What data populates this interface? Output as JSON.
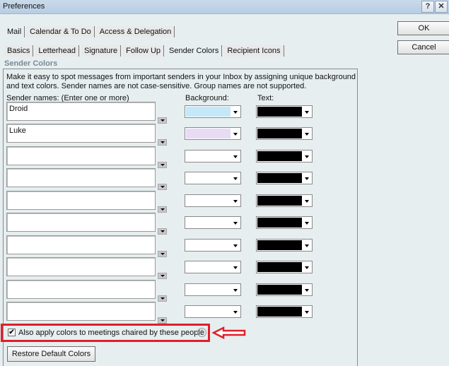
{
  "window": {
    "title": "Preferences",
    "help_glyph": "?",
    "close_glyph": "✕"
  },
  "top_tabs": [
    {
      "label": "Mail",
      "active": true
    },
    {
      "label": "Calendar & To Do",
      "active": false
    },
    {
      "label": "Access & Delegation",
      "active": false
    }
  ],
  "sub_tabs": [
    {
      "label": "Basics",
      "active": false
    },
    {
      "label": "Letterhead",
      "active": false
    },
    {
      "label": "Signature",
      "active": false
    },
    {
      "label": "Follow Up",
      "active": false
    },
    {
      "label": "Sender Colors",
      "active": true
    },
    {
      "label": "Recipient Icons",
      "active": false
    }
  ],
  "buttons": {
    "ok": "OK",
    "cancel": "Cancel",
    "restore": "Restore Default Colors"
  },
  "section": {
    "title": "Sender Colors",
    "description": "Make it easy to spot messages from important senders in your Inbox by assigning unique background and text colors.  Sender names are not case-sensitive. Group names are not supported.",
    "col_names": "Sender names: (Enter one or more)",
    "col_background": "Background:",
    "col_text": "Text:"
  },
  "rows": [
    {
      "name": "Droid",
      "background": "#c4e8f8",
      "text": "#000000"
    },
    {
      "name": "Luke",
      "background": "#e8dcf4",
      "text": "#000000"
    },
    {
      "name": "",
      "background": "#ffffff",
      "text": "#000000"
    },
    {
      "name": "",
      "background": "#ffffff",
      "text": "#000000"
    },
    {
      "name": "",
      "background": "#ffffff",
      "text": "#000000"
    },
    {
      "name": "",
      "background": "#ffffff",
      "text": "#000000"
    },
    {
      "name": "",
      "background": "#ffffff",
      "text": "#000000"
    },
    {
      "name": "",
      "background": "#ffffff",
      "text": "#000000"
    },
    {
      "name": "",
      "background": "#ffffff",
      "text": "#000000"
    },
    {
      "name": "",
      "background": "#ffffff",
      "text": "#000000"
    }
  ],
  "apply_meetings": {
    "label": "Also apply colors to meetings chaired by these people",
    "checked": true,
    "check_glyph": "✔",
    "help_glyph": "?"
  },
  "annotation": {
    "highlight_color": "#e01f2a"
  }
}
